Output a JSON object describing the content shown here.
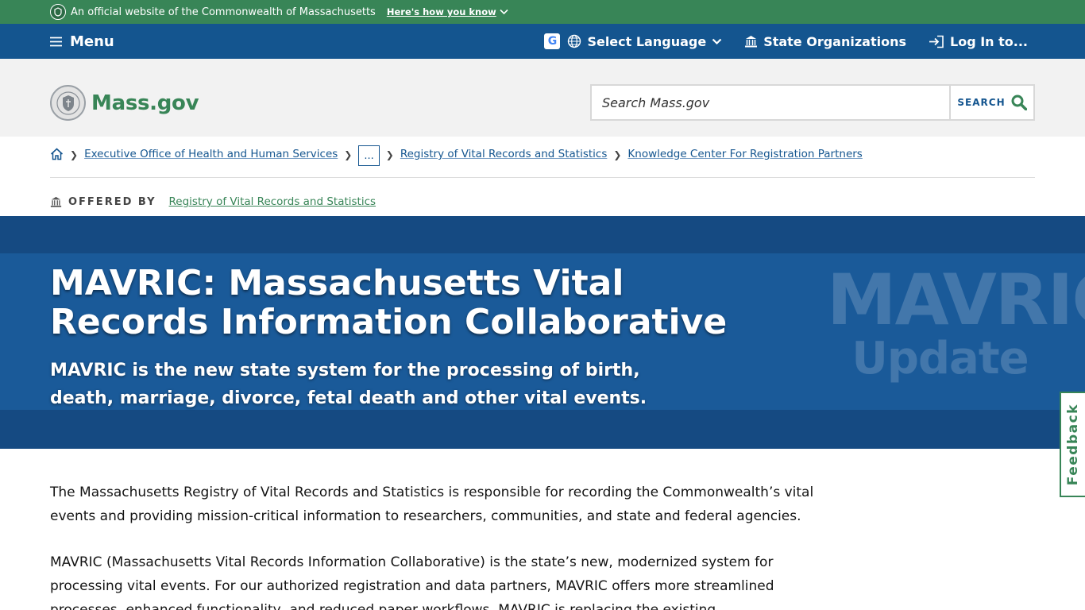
{
  "official_banner": {
    "text": "An official website of the Commonwealth of Massachusetts",
    "how_label": "Here's how you know"
  },
  "utility_nav": {
    "menu_label": "Menu",
    "language_label": "Select Language",
    "state_orgs_label": "State Organizations",
    "login_label": "Log In to..."
  },
  "header": {
    "logo_text": "Mass.gov",
    "search": {
      "placeholder": "Search Mass.gov",
      "button_label": "SEARCH"
    }
  },
  "breadcrumb": {
    "items": [
      "Executive Office of Health and Human Services",
      "...",
      "Registry of Vital Records and Statistics",
      "Knowledge Center For Registration Partners"
    ]
  },
  "offered_by": {
    "label": "OFFERED BY",
    "org": "Registry of Vital Records and Statistics"
  },
  "hero": {
    "title": "MAVRIC: Massachusetts Vital Records Information Collaborative",
    "subtitle": "MAVRIC is the new state system for the processing of birth, death, marriage, divorce, fetal death and other vital events.",
    "watermark_line1": "MAVRIC",
    "watermark_line2": "Update"
  },
  "feedback_label": "Feedback",
  "content": {
    "paragraphs": [
      "The Massachusetts Registry of Vital Records and Statistics is responsible for recording the Commonwealth’s vital events and providing mission-critical information to researchers, communities, and state and federal agencies.",
      "MAVRIC (Massachusetts Vital Records Information Collaborative) is the state’s new, modernized system for processing vital events. For our authorized registration and data partners, MAVRIC offers more streamlined processes, enhanced functionality, and reduced paper workflows. MAVRIC is replacing the existing"
    ]
  },
  "colors": {
    "banner_green": "#388557",
    "nav_blue": "#14558f",
    "hero_dark": "#154a82",
    "hero_band": "#1a5a99"
  }
}
